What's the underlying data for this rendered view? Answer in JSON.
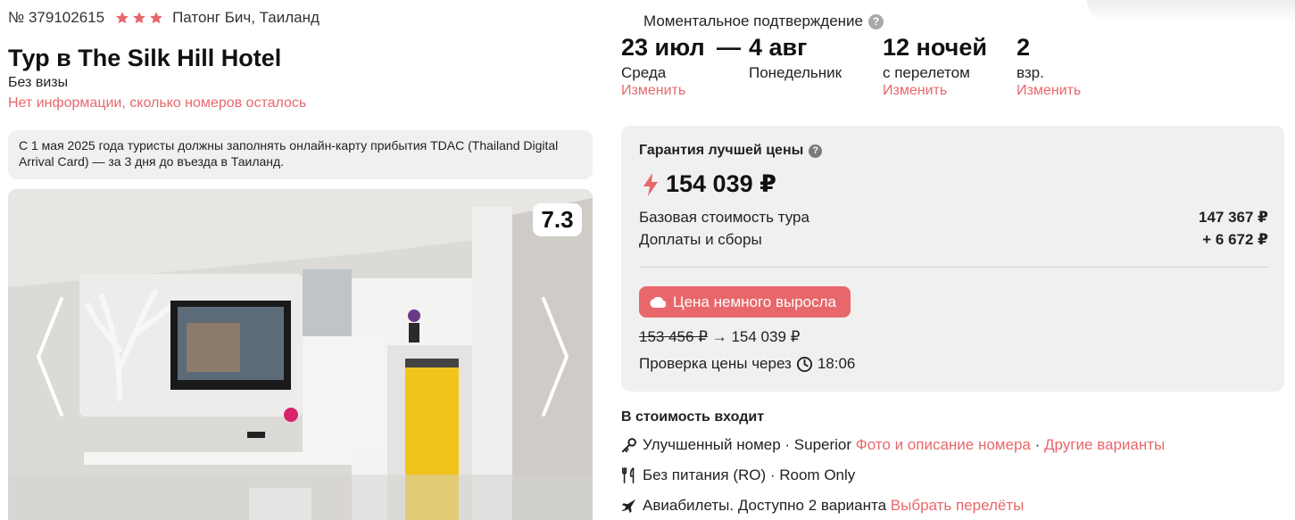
{
  "hotel": {
    "tour_number": "№ 379102615",
    "stars": 3,
    "location": "Патонг Бич, Таиланд",
    "title": "Тур в The Silk Hill Hotel",
    "visa": "Без визы",
    "rooms_note": "Нет информации, сколько номеров осталось",
    "notice": "С 1 мая 2025 года туристы должны заполнять онлайн-карту прибытия TDAC (Thailand Digital Arrival Card) — за 3 дня до въезда в Таиланд.",
    "rating": "7.3"
  },
  "booking": {
    "instant_confirmation": "Моментальное подтверждение",
    "date_from": "23 июл",
    "date_from_day": "Среда",
    "change_label": "Изменить",
    "dash": "—",
    "date_to": "4 авг",
    "date_to_day": "Понедельник",
    "nights": "12 ночей",
    "nights_sub": "с перелетом",
    "adults": "2",
    "adults_sub": "взр."
  },
  "price": {
    "guarantee": "Гарантия лучшей цены",
    "total": "154 039 ₽",
    "base_label": "Базовая стоимость тура",
    "base_value": "147 367 ₽",
    "fees_label": "Доплаты и сборы",
    "fees_value": "+ 6 672 ₽",
    "badge": "Цена немного выросла",
    "old_price": "153 456 ₽",
    "arrow": "→",
    "new_price": "154 039 ₽",
    "check_label": "Проверка цены через",
    "check_time": "18:06"
  },
  "included": {
    "title": "В стоимость входит",
    "room_text": "Улучшенный номер · Superior",
    "room_photo_link": "Фото и описание номера",
    "separator": "·",
    "room_other_link": "Другие варианты",
    "meal_text": "Без питания (RO) · Room Only",
    "flight_text": "Авиабилеты. Доступно 2 варианта",
    "flight_link": "Выбрать перелёты"
  },
  "colors": {
    "accent": "#e8676b",
    "star": "#e8676b",
    "card_bg": "#f0f0f0"
  }
}
